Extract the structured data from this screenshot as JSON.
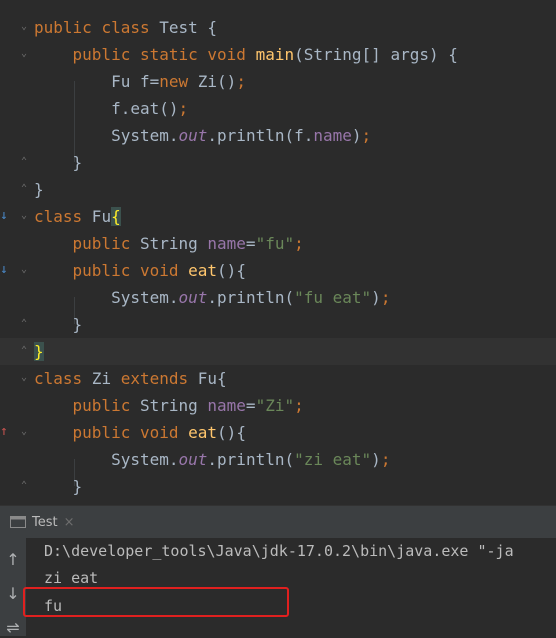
{
  "editor": {
    "lines": [
      {
        "tokens": [
          {
            "t": "public",
            "c": "kw"
          },
          {
            "t": " "
          },
          {
            "t": "class",
            "c": "kw"
          },
          {
            "t": " Test {"
          }
        ]
      },
      {
        "tokens": [
          {
            "t": "    "
          },
          {
            "t": "public",
            "c": "kw"
          },
          {
            "t": " "
          },
          {
            "t": "static",
            "c": "kw"
          },
          {
            "t": " "
          },
          {
            "t": "void",
            "c": "kw"
          },
          {
            "t": " "
          },
          {
            "t": "main",
            "c": "fn"
          },
          {
            "t": "(String[] args) {"
          }
        ]
      },
      {
        "tokens": [
          {
            "t": "        Fu f="
          },
          {
            "t": "new",
            "c": "kw"
          },
          {
            "t": " Zi()"
          },
          {
            "t": ";",
            "c": "kw"
          }
        ]
      },
      {
        "tokens": [
          {
            "t": "        f.eat()"
          },
          {
            "t": ";",
            "c": "kw"
          }
        ]
      },
      {
        "tokens": [
          {
            "t": "        System."
          },
          {
            "t": "out",
            "c": "it"
          },
          {
            "t": ".println(f."
          },
          {
            "t": "name",
            "c": "fld"
          },
          {
            "t": ")"
          },
          {
            "t": ";",
            "c": "kw"
          }
        ]
      },
      {
        "tokens": [
          {
            "t": "    }"
          }
        ]
      },
      {
        "tokens": [
          {
            "t": "}"
          }
        ]
      },
      {
        "tokens": [
          {
            "t": "class",
            "c": "kw"
          },
          {
            "t": " Fu"
          },
          {
            "t": "{",
            "c": "brace-hl"
          }
        ]
      },
      {
        "tokens": [
          {
            "t": "    "
          },
          {
            "t": "public",
            "c": "kw"
          },
          {
            "t": " String "
          },
          {
            "t": "name",
            "c": "fld"
          },
          {
            "t": "="
          },
          {
            "t": "\"fu\"",
            "c": "str"
          },
          {
            "t": ";",
            "c": "kw"
          }
        ]
      },
      {
        "tokens": [
          {
            "t": "    "
          },
          {
            "t": "public",
            "c": "kw"
          },
          {
            "t": " "
          },
          {
            "t": "void",
            "c": "kw"
          },
          {
            "t": " "
          },
          {
            "t": "eat",
            "c": "fn"
          },
          {
            "t": "(){"
          }
        ]
      },
      {
        "tokens": [
          {
            "t": "        System."
          },
          {
            "t": "out",
            "c": "it"
          },
          {
            "t": ".println("
          },
          {
            "t": "\"fu eat\"",
            "c": "str"
          },
          {
            "t": ")"
          },
          {
            "t": ";",
            "c": "kw"
          }
        ]
      },
      {
        "tokens": [
          {
            "t": "    }"
          }
        ]
      },
      {
        "tokens": [
          {
            "t": "}",
            "c": "brace-hl"
          }
        ]
      },
      {
        "tokens": [
          {
            "t": "class",
            "c": "kw"
          },
          {
            "t": " Zi "
          },
          {
            "t": "extends",
            "c": "kw"
          },
          {
            "t": " Fu{"
          }
        ]
      },
      {
        "tokens": [
          {
            "t": "    "
          },
          {
            "t": "public",
            "c": "kw"
          },
          {
            "t": " String "
          },
          {
            "t": "name",
            "c": "fld"
          },
          {
            "t": "="
          },
          {
            "t": "\"Zi\"",
            "c": "str"
          },
          {
            "t": ";",
            "c": "kw"
          }
        ]
      },
      {
        "tokens": [
          {
            "t": "    "
          },
          {
            "t": "public",
            "c": "kw"
          },
          {
            "t": " "
          },
          {
            "t": "void",
            "c": "kw"
          },
          {
            "t": " "
          },
          {
            "t": "eat",
            "c": "fn"
          },
          {
            "t": "(){"
          }
        ]
      },
      {
        "tokens": [
          {
            "t": "        System."
          },
          {
            "t": "out",
            "c": "it"
          },
          {
            "t": ".println("
          },
          {
            "t": "\"zi eat\"",
            "c": "str"
          },
          {
            "t": ")"
          },
          {
            "t": ";",
            "c": "kw"
          }
        ]
      },
      {
        "tokens": [
          {
            "t": "    }"
          }
        ]
      }
    ],
    "colors": {
      "keyword": "#cc7832",
      "method": "#ffc66d",
      "field": "#9876aa",
      "string": "#6a8759",
      "text": "#a9b7c6",
      "background": "#2b2b2b"
    }
  },
  "run_panel": {
    "tab_label": "Test",
    "tab_close": "×",
    "tool_up": "↑",
    "tool_down": "↓",
    "tool_wrap": "⇌",
    "output": [
      "D:\\developer_tools\\Java\\jdk-17.0.2\\bin\\java.exe \"-ja",
      "zi eat",
      "fu"
    ],
    "highlight_color": "#e0201f"
  }
}
